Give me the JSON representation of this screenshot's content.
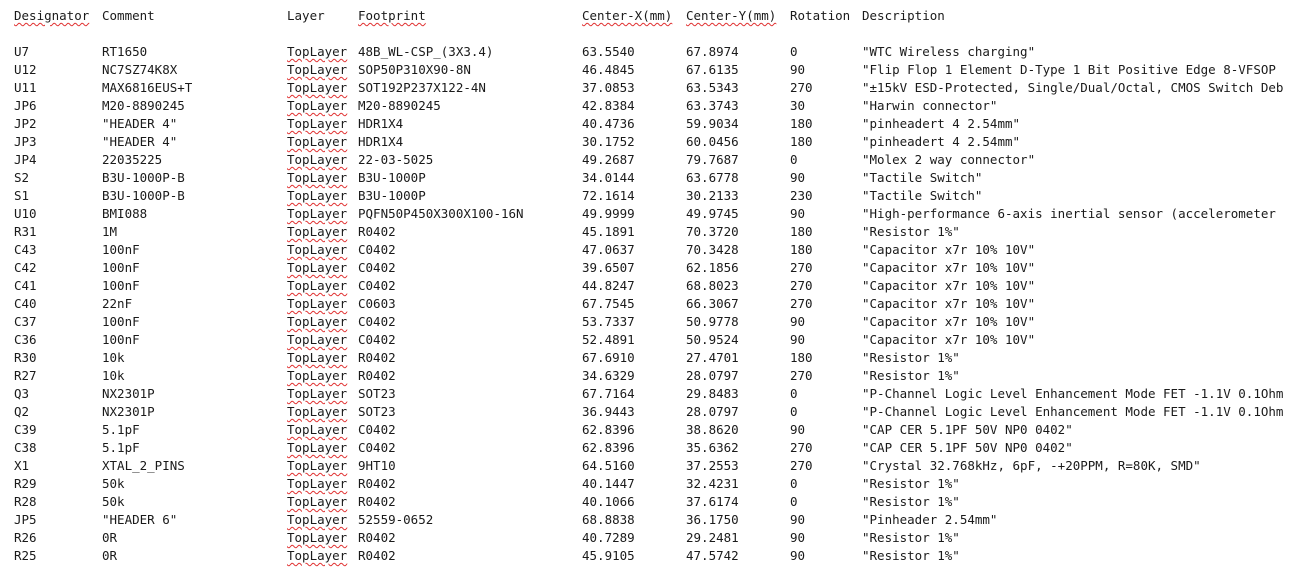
{
  "header": {
    "designator": "Designator",
    "comment": "Comment",
    "layer": "Layer",
    "footprint": "Footprint",
    "center_x": "Center-X(mm)",
    "center_y": "Center-Y(mm)",
    "rotation": "Rotation",
    "description": "Description"
  },
  "rows": [
    {
      "designator": "U7",
      "comment": "RT1650",
      "layer": "TopLayer",
      "footprint": "48B_WL-CSP_(3X3.4)",
      "cx": "63.5540",
      "cy": "67.8974",
      "rotation": "0",
      "description": "\"WTC Wireless charging\""
    },
    {
      "designator": "U12",
      "comment": "NC7SZ74K8X",
      "layer": "TopLayer",
      "footprint": "SOP50P310X90-8N",
      "cx": "46.4845",
      "cy": "67.6135",
      "rotation": "90",
      "description": "\"Flip Flop 1 Element D-Type 1 Bit Positive Edge 8-VFSOP"
    },
    {
      "designator": "U11",
      "comment": "MAX6816EUS+T",
      "layer": "TopLayer",
      "footprint": "SOT192P237X122-4N",
      "cx": "37.0853",
      "cy": "63.5343",
      "rotation": "270",
      "description": "\"±15kV ESD-Protected, Single/Dual/Octal, CMOS Switch Deb"
    },
    {
      "designator": "JP6",
      "comment": "M20-8890245",
      "layer": "TopLayer",
      "footprint": "M20-8890245",
      "cx": "42.8384",
      "cy": "63.3743",
      "rotation": "30",
      "description": "\"Harwin connector\""
    },
    {
      "designator": "JP2",
      "comment": "\"HEADER 4\"",
      "layer": "TopLayer",
      "footprint": "HDR1X4",
      "cx": "40.4736",
      "cy": "59.9034",
      "rotation": "180",
      "description": "\"pinheadert 4 2.54mm\""
    },
    {
      "designator": "JP3",
      "comment": "\"HEADER 4\"",
      "layer": "TopLayer",
      "footprint": "HDR1X4",
      "cx": "30.1752",
      "cy": "60.0456",
      "rotation": "180",
      "description": "\"pinheadert 4 2.54mm\""
    },
    {
      "designator": "JP4",
      "comment": "22035225",
      "layer": "TopLayer",
      "footprint": "22-03-5025",
      "cx": "49.2687",
      "cy": "79.7687",
      "rotation": "0",
      "description": "\"Molex 2 way connector\""
    },
    {
      "designator": "S2",
      "comment": "B3U-1000P-B",
      "layer": "TopLayer",
      "footprint": "B3U-1000P",
      "cx": "34.0144",
      "cy": "63.6778",
      "rotation": "90",
      "description": "\"Tactile Switch\""
    },
    {
      "designator": "S1",
      "comment": "B3U-1000P-B",
      "layer": "TopLayer",
      "footprint": "B3U-1000P",
      "cx": "72.1614",
      "cy": "30.2133",
      "rotation": "230",
      "description": "\"Tactile Switch\""
    },
    {
      "designator": "U10",
      "comment": "BMI088",
      "layer": "TopLayer",
      "footprint": "PQFN50P450X300X100-16N",
      "cx": "49.9999",
      "cy": "49.9745",
      "rotation": "90",
      "description": "\"High-performance 6-axis inertial sensor (accelerometer"
    },
    {
      "designator": "R31",
      "comment": "1M",
      "layer": "TopLayer",
      "footprint": "R0402",
      "cx": "45.1891",
      "cy": "70.3720",
      "rotation": "180",
      "description": "\"Resistor 1%\""
    },
    {
      "designator": "C43",
      "comment": "100nF",
      "layer": "TopLayer",
      "footprint": "C0402",
      "cx": "47.0637",
      "cy": "70.3428",
      "rotation": "180",
      "description": "\"Capacitor x7r 10% 10V\""
    },
    {
      "designator": "C42",
      "comment": "100nF",
      "layer": "TopLayer",
      "footprint": "C0402",
      "cx": "39.6507",
      "cy": "62.1856",
      "rotation": "270",
      "description": "\"Capacitor x7r 10% 10V\""
    },
    {
      "designator": "C41",
      "comment": "100nF",
      "layer": "TopLayer",
      "footprint": "C0402",
      "cx": "44.8247",
      "cy": "68.8023",
      "rotation": "270",
      "description": "\"Capacitor x7r 10% 10V\""
    },
    {
      "designator": "C40",
      "comment": "22nF",
      "layer": "TopLayer",
      "footprint": "C0603",
      "cx": "67.7545",
      "cy": "66.3067",
      "rotation": "270",
      "description": "\"Capacitor x7r 10% 10V\""
    },
    {
      "designator": "C37",
      "comment": "100nF",
      "layer": "TopLayer",
      "footprint": "C0402",
      "cx": "53.7337",
      "cy": "50.9778",
      "rotation": "90",
      "description": "\"Capacitor x7r 10% 10V\""
    },
    {
      "designator": "C36",
      "comment": "100nF",
      "layer": "TopLayer",
      "footprint": "C0402",
      "cx": "52.4891",
      "cy": "50.9524",
      "rotation": "90",
      "description": "\"Capacitor x7r 10% 10V\""
    },
    {
      "designator": "R30",
      "comment": "10k",
      "layer": "TopLayer",
      "footprint": "R0402",
      "cx": "67.6910",
      "cy": "27.4701",
      "rotation": "180",
      "description": "\"Resistor 1%\""
    },
    {
      "designator": "R27",
      "comment": "10k",
      "layer": "TopLayer",
      "footprint": "R0402",
      "cx": "34.6329",
      "cy": "28.0797",
      "rotation": "270",
      "description": "\"Resistor 1%\""
    },
    {
      "designator": "Q3",
      "comment": "NX2301P",
      "layer": "TopLayer",
      "footprint": "SOT23",
      "cx": "67.7164",
      "cy": "29.8483",
      "rotation": "0",
      "description": "\"P-Channel Logic Level Enhancement Mode FET -1.1V 0.1Ohm"
    },
    {
      "designator": "Q2",
      "comment": "NX2301P",
      "layer": "TopLayer",
      "footprint": "SOT23",
      "cx": "36.9443",
      "cy": "28.0797",
      "rotation": "0",
      "description": "\"P-Channel Logic Level Enhancement Mode FET -1.1V 0.1Ohm"
    },
    {
      "designator": "C39",
      "comment": "5.1pF",
      "layer": "TopLayer",
      "footprint": "C0402",
      "cx": "62.8396",
      "cy": "38.8620",
      "rotation": "90",
      "description": "\"CAP CER 5.1PF 50V NP0 0402\""
    },
    {
      "designator": "C38",
      "comment": "5.1pF",
      "layer": "TopLayer",
      "footprint": "C0402",
      "cx": "62.8396",
      "cy": "35.6362",
      "rotation": "270",
      "description": "\"CAP CER 5.1PF 50V NP0 0402\""
    },
    {
      "designator": "X1",
      "comment": "XTAL_2_PINS",
      "layer": "TopLayer",
      "footprint": "9HT10",
      "cx": "64.5160",
      "cy": "37.2553",
      "rotation": "270",
      "description": "\"Crystal 32.768kHz, 6pF, -+20PPM, R=80K, SMD\""
    },
    {
      "designator": "R29",
      "comment": "50k",
      "layer": "TopLayer",
      "footprint": "R0402",
      "cx": "40.1447",
      "cy": "32.4231",
      "rotation": "0",
      "description": "\"Resistor 1%\""
    },
    {
      "designator": "R28",
      "comment": "50k",
      "layer": "TopLayer",
      "footprint": "R0402",
      "cx": "40.1066",
      "cy": "37.6174",
      "rotation": "0",
      "description": "\"Resistor 1%\""
    },
    {
      "designator": "JP5",
      "comment": "\"HEADER 6\"",
      "layer": "TopLayer",
      "footprint": "52559-0652",
      "cx": "68.8838",
      "cy": "36.1750",
      "rotation": "90",
      "description": "\"Pinheader 2.54mm\""
    },
    {
      "designator": "R26",
      "comment": "0R",
      "layer": "TopLayer",
      "footprint": "R0402",
      "cx": "40.7289",
      "cy": "29.2481",
      "rotation": "90",
      "description": "\"Resistor 1%\""
    },
    {
      "designator": "R25",
      "comment": "0R",
      "layer": "TopLayer",
      "footprint": "R0402",
      "cx": "45.9105",
      "cy": "47.5742",
      "rotation": "90",
      "description": "\"Resistor 1%\""
    }
  ]
}
